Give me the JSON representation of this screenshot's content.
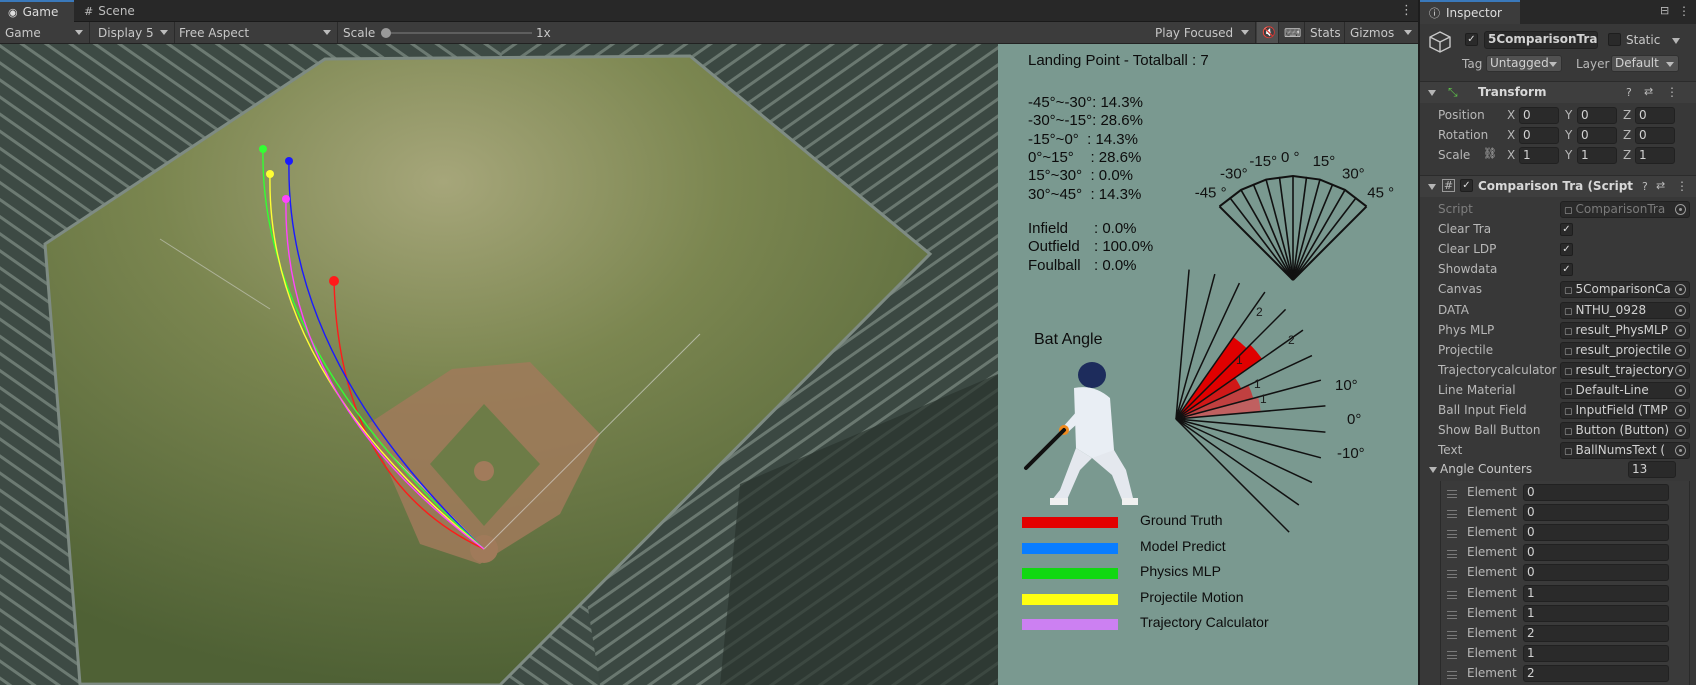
{
  "tabs": {
    "game": "Game",
    "scene": "Scene"
  },
  "toolbar": {
    "view": "Game",
    "display": "Display 5",
    "aspect": "Free Aspect",
    "scale_label": "Scale",
    "scale_value": "1x",
    "scale_fraction": 0.0,
    "play_mode": "Play Focused",
    "stats": "Stats",
    "gizmos": "Gizmos"
  },
  "field": {
    "balls": [
      {
        "name": "Ground Truth",
        "color": "#ff1a1a"
      },
      {
        "name": "Model Predict",
        "color": "#1a1aff"
      },
      {
        "name": "Physics MLP",
        "color": "#33ff33"
      },
      {
        "name": "Projectile Motion",
        "color": "#ffff33"
      },
      {
        "name": "Trajectory Calculator",
        "color": "#ff44ff"
      }
    ]
  },
  "panel": {
    "title": "Landing Point - Totalball  : 7",
    "ranges": [
      {
        "label": "-45°~-30°",
        "value": ": 14.3%"
      },
      {
        "label": "-30°~-15°",
        "value": ": 28.6%"
      },
      {
        "label": "-15°~0°",
        "value": "  : 14.3%"
      },
      {
        "label": "0°~15°",
        "value": "    : 28.6%"
      },
      {
        "label": "15°~30°",
        "value": "  : 0.0%"
      },
      {
        "label": "30°~45°",
        "value": "  : 14.3%"
      }
    ],
    "zones": [
      {
        "label": "Infield",
        "value": ": 0.0%"
      },
      {
        "label": "Outfield",
        "value": ": 100.0%"
      },
      {
        "label": "Foulball",
        "value": ": 0.0%"
      }
    ],
    "fan_labels": [
      "-45 °",
      "-30°",
      "-15°",
      "0 °",
      "15°",
      "30°",
      "45 °"
    ],
    "bat_angle_title": "Bat Angle",
    "bat_labels": [
      "10°",
      "0°",
      "-10°"
    ],
    "bat_counts": [
      "2",
      "2",
      "1",
      "1",
      "1"
    ],
    "legend": [
      {
        "name": "Ground Truth",
        "color": "#e30000"
      },
      {
        "name": "Model Predict",
        "color": "#0a7dff"
      },
      {
        "name": "Physics MLP",
        "color": "#11d811"
      },
      {
        "name": "Projectile Motion",
        "color": "#ffff10"
      },
      {
        "name": "Trajectory Calculator",
        "color": "#cc80f2"
      }
    ]
  },
  "inspector": {
    "tab": "Inspector",
    "object_name": "5ComparisonTra",
    "static_label": "Static",
    "tag_label": "Tag",
    "tag_value": "Untagged",
    "layer_label": "Layer",
    "layer_value": "Default",
    "transform": {
      "title": "Transform",
      "rows": [
        {
          "label": "Position",
          "x": "0",
          "y": "0",
          "z": "0"
        },
        {
          "label": "Rotation",
          "x": "0",
          "y": "0",
          "z": "0"
        },
        {
          "label": "Scale",
          "x": "1",
          "y": "1",
          "z": "1"
        }
      ],
      "axis": [
        "X",
        "Y",
        "Z"
      ]
    },
    "script": {
      "title": "Comparison Tra (Script",
      "fields": [
        {
          "label": "Script",
          "value": "ComparisonTra",
          "kind": "ref-dim"
        },
        {
          "label": "Clear Tra",
          "value": "✓",
          "kind": "check"
        },
        {
          "label": "Clear LDP",
          "value": "✓",
          "kind": "check"
        },
        {
          "label": "Showdata",
          "value": "✓",
          "kind": "check"
        },
        {
          "label": "Canvas",
          "value": "5ComparisonCa",
          "kind": "ref"
        },
        {
          "label": "DATA",
          "value": "NTHU_0928",
          "kind": "ref"
        },
        {
          "label": "Phys MLP",
          "value": "result_PhysMLP",
          "kind": "ref"
        },
        {
          "label": "Projectile",
          "value": "result_projectile",
          "kind": "ref"
        },
        {
          "label": "Trajectorycalculator",
          "value": "result_trajectory",
          "kind": "ref"
        },
        {
          "label": "Line Material",
          "value": "Default-Line",
          "kind": "ref"
        },
        {
          "label": "Ball Input Field",
          "value": "InputField (TMP",
          "kind": "ref"
        },
        {
          "label": "Show Ball Button",
          "value": "Button (Button)",
          "kind": "ref"
        },
        {
          "label": "Text",
          "value": "BallNumsText (",
          "kind": "ref"
        }
      ]
    },
    "angle_counters": {
      "title": "Angle Counters",
      "count": "13",
      "elements": [
        {
          "label": "Element 0",
          "value": "0"
        },
        {
          "label": "Element 1",
          "value": "0"
        },
        {
          "label": "Element 2",
          "value": "0"
        },
        {
          "label": "Element 3",
          "value": "0"
        },
        {
          "label": "Element 4",
          "value": "0"
        },
        {
          "label": "Element 5",
          "value": "1"
        },
        {
          "label": "Element 6",
          "value": "1"
        },
        {
          "label": "Element 7",
          "value": "2"
        },
        {
          "label": "Element 8",
          "value": "1"
        },
        {
          "label": "Element 9",
          "value": "2"
        }
      ]
    }
  }
}
